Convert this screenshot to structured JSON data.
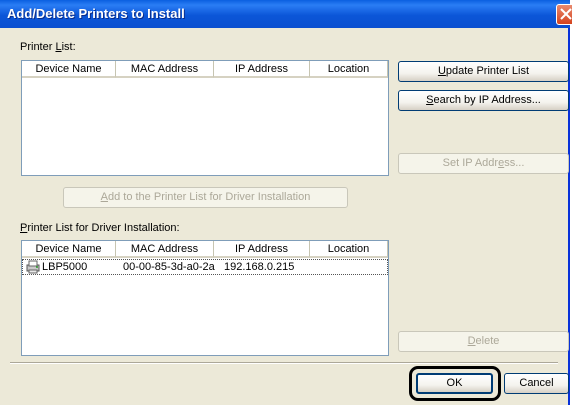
{
  "window": {
    "title": "Add/Delete Printers to Install"
  },
  "printer_list": {
    "label_prefix": "Printer ",
    "label_mnemonic": "L",
    "label_suffix": "ist:",
    "columns": [
      "Device Name",
      "MAC Address",
      "IP Address",
      "Location"
    ],
    "rows": []
  },
  "buttons": {
    "update_printer_list": {
      "pre": "",
      "mn": "U",
      "post": "pdate Printer List"
    },
    "search_by_ip": {
      "pre": "",
      "mn": "S",
      "post": "earch by IP Address..."
    },
    "set_ip": {
      "pre": "Set IP Addr",
      "mn": "e",
      "post": "ss..."
    },
    "add_to_list": {
      "pre": "",
      "mn": "A",
      "post": "dd to the Printer List for Driver Installation"
    },
    "delete": {
      "pre": "",
      "mn": "D",
      "post": "elete"
    },
    "ok": "OK",
    "cancel": "Cancel"
  },
  "driver_list": {
    "label_mnemonic": "P",
    "label_rest": "rinter List for Driver Installation:",
    "columns": [
      "Device Name",
      "MAC Address",
      "IP Address",
      "Location"
    ],
    "rows": [
      {
        "device_name": "LBP5000",
        "mac": "00-00-85-3d-a0-2a",
        "ip": "192.168.0.215",
        "location": ""
      }
    ]
  }
}
